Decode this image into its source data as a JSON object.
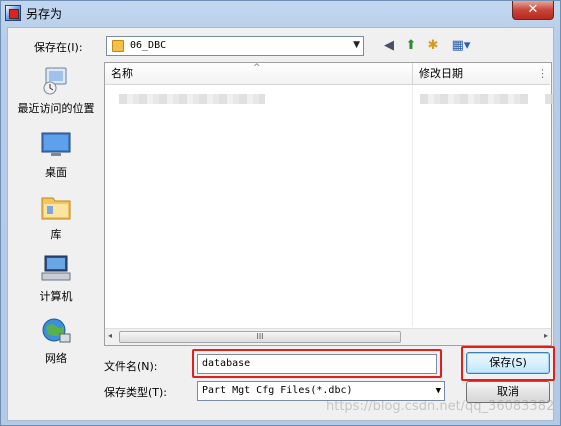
{
  "window": {
    "title": "另存为",
    "close_glyph": "✕"
  },
  "top_bar": {
    "save_in_label": "保存在(I):",
    "save_in_value": "06_DBC",
    "dropdown_glyph": "▼"
  },
  "toolbar": {
    "back_glyph": "◀",
    "up_glyph": "⬆",
    "new_folder_glyph": "✱",
    "views_glyph": "▦▾"
  },
  "places": [
    {
      "label": "最近访问的位置",
      "icon": "recent-places-icon"
    },
    {
      "label": "桌面",
      "icon": "desktop-icon"
    },
    {
      "label": "库",
      "icon": "libraries-icon"
    },
    {
      "label": "计算机",
      "icon": "computer-icon"
    },
    {
      "label": "网络",
      "icon": "network-icon"
    }
  ],
  "file_list": {
    "columns": [
      "名称",
      "修改日期"
    ],
    "sort_glyph": "^",
    "more_glyph": "⋮",
    "scroll_grip": "III",
    "left_arrow": "◂",
    "right_arrow": "▸"
  },
  "bottom": {
    "filename_label": "文件名(N):",
    "filename_value": "database",
    "filetype_label": "保存类型(T):",
    "filetype_value": "Part Mgt Cfg Files(*.dbc)",
    "save_button": "保存(S)",
    "cancel_button": "取消"
  },
  "watermark": "https://blog.csdn.net/qq_36083382",
  "colors": {
    "highlight_box": "#e0201a",
    "default_button_border": "#3c7fb1"
  }
}
